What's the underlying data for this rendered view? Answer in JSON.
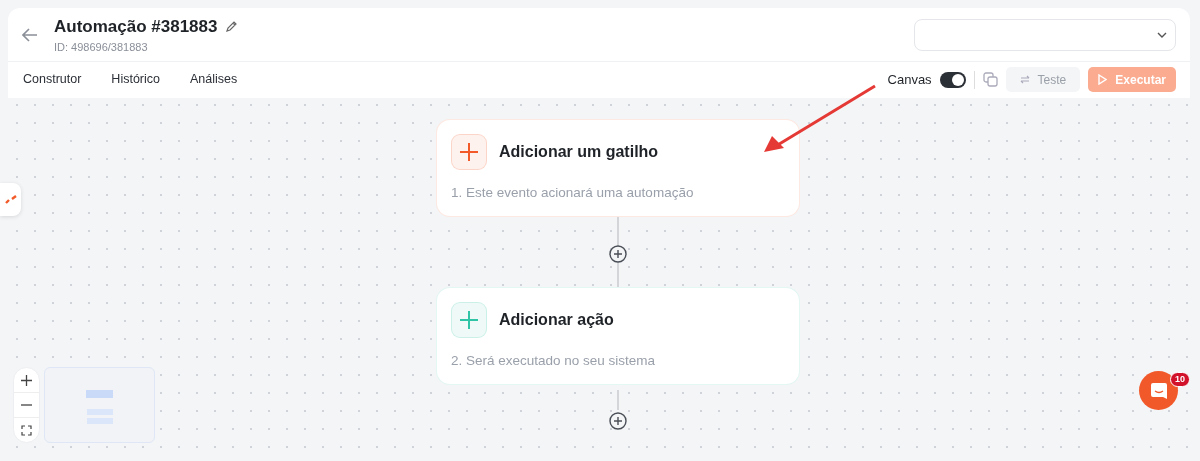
{
  "header": {
    "title": "Automação #381883",
    "subtitle": "ID: 498696/381883"
  },
  "tabs": [
    {
      "label": "Construtor",
      "selected": false
    },
    {
      "label": "Histórico",
      "selected": false
    },
    {
      "label": "Análises",
      "selected": false
    }
  ],
  "toolbar": {
    "canvas_label": "Canvas",
    "canvas_on": true,
    "test_button": {
      "label": "Teste",
      "disabled": true
    },
    "run_button": {
      "label": "Executar",
      "disabled": true
    }
  },
  "nodes": [
    {
      "title": "Adicionar um gatilho",
      "description": "1. Este evento acionará uma automação",
      "color": "#f25a29"
    },
    {
      "title": "Adicionar ação",
      "description": "2. Será executado no seu sistema",
      "color": "#2ec4a5"
    }
  ],
  "chat": {
    "badge": "10"
  }
}
